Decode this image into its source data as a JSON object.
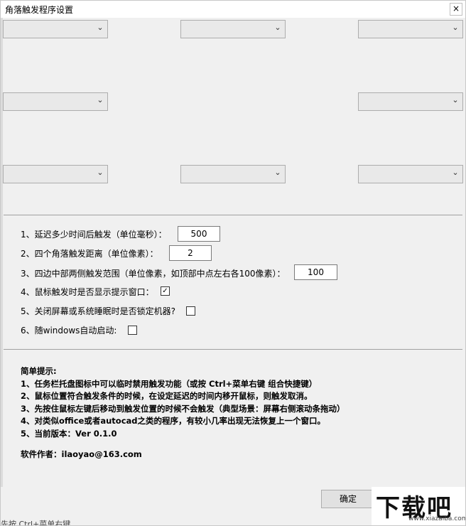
{
  "window": {
    "title": "角落触发程序设置",
    "close_label": "×"
  },
  "dropdowns": [
    {
      "name": "top-left",
      "value": ""
    },
    {
      "name": "top-center",
      "value": ""
    },
    {
      "name": "top-right",
      "value": ""
    },
    {
      "name": "middle-left",
      "value": ""
    },
    {
      "name": "middle-right",
      "value": ""
    },
    {
      "name": "bottom-left",
      "value": ""
    },
    {
      "name": "bottom-center",
      "value": ""
    },
    {
      "name": "bottom-right",
      "value": ""
    }
  ],
  "options": {
    "delay_label": "1、延迟多少时间后触发（单位毫秒）：",
    "delay_value": "500",
    "corner_label": "2、四个角落触发距离（单位像素）：",
    "corner_value": "2",
    "edge_label": "3、四边中部两侧触发范围（单位像素，如顶部中点左右各100像素）：",
    "edge_value": "100",
    "show_tip_label": "4、鼠标触发时是否显示提示窗口：",
    "show_tip_checked": true,
    "lock_label": "5、关闭屏幕或系统睡眠时是否锁定机器?",
    "lock_checked": false,
    "autostart_label": "6、随windows自动启动:",
    "autostart_checked": false
  },
  "hints": {
    "heading": "简单提示:",
    "lines": [
      "1、任务栏托盘图标中可以临时禁用触发功能（或按 Ctrl+菜单右键 组合快捷键）",
      "2、鼠标位置符合触发条件的时候，在设定延迟的时间内移开鼠标，则触发取消。",
      "3、先按住鼠标左键后移动到触发位置的时候不会触发（典型场景：屏幕右侧滚动条拖动）",
      "4、对类似office或者autocad之类的程序，有较小几率出现无法恢复上一个窗口。",
      "5、当前版本：Ver 0.1.0"
    ],
    "author": "软件作者：ilaoyao@163.com"
  },
  "ok_label": "确定",
  "watermark": {
    "text": "下载吧",
    "sub": "www.xiazaiba.com"
  },
  "background_text": "先按 Ctrl+菜单右键 ..."
}
